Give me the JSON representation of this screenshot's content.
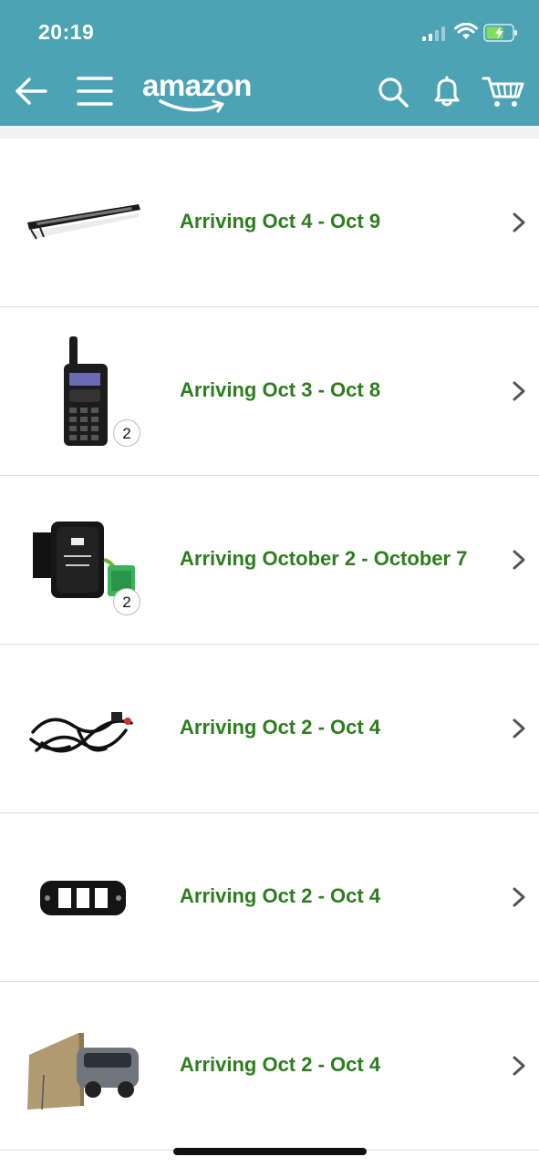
{
  "status_bar": {
    "time": "20:19"
  },
  "header": {
    "logo_text": "amazon"
  },
  "deliveries": [
    {
      "arrival": "Arriving Oct 4 - Oct 9",
      "product_icon": "led-light-bar",
      "quantity": ""
    },
    {
      "arrival": "Arriving Oct 3 - Oct 8",
      "product_icon": "two-way-radio",
      "quantity": "2"
    },
    {
      "arrival": "Arriving October 2 - October 7",
      "product_icon": "led-light-switch",
      "quantity": "2"
    },
    {
      "arrival": "Arriving Oct 2 - Oct 4",
      "product_icon": "wiring-harness",
      "quantity": ""
    },
    {
      "arrival": "Arriving Oct 2 - Oct 4",
      "product_icon": "switch-panel",
      "quantity": ""
    },
    {
      "arrival": "Arriving Oct 2 - Oct 4",
      "product_icon": "car-awning",
      "quantity": ""
    }
  ],
  "colors": {
    "header_bg": "#4ba3b4",
    "arrival_text": "#2e7d1f"
  }
}
